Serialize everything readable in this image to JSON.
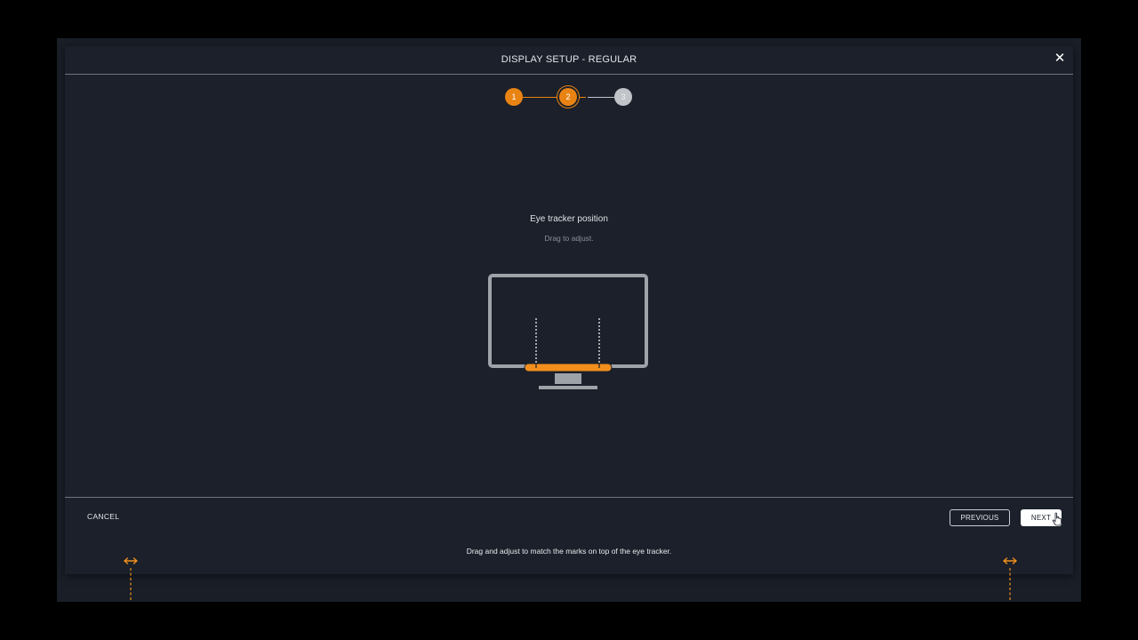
{
  "dialog": {
    "title": "DISPLAY SETUP - REGULAR",
    "close_icon": "close-icon",
    "close_glyph": "✕"
  },
  "stepper": {
    "steps": [
      {
        "label": "1",
        "state": "completed"
      },
      {
        "label": "2",
        "state": "active"
      },
      {
        "label": "3",
        "state": "pending"
      }
    ],
    "current_step": 2,
    "active_color": "#e98414",
    "pending_color": "#c0c4c9"
  },
  "content": {
    "title": "Eye tracker position",
    "hint": "Drag to adjust.",
    "illustration": {
      "monitor_color": "#9ea3aa",
      "tracker_color": "#f28f1c",
      "icon": "monitor-with-eye-tracker-icon"
    }
  },
  "footer": {
    "cancel_label": "CANCEL",
    "previous_label": "PREVIOUS",
    "next_label": "NEXT"
  },
  "screen_overlay": {
    "instruction": "Drag and adjust to match the marks on top of the eye tracker.",
    "marker_icon": "horizontal-resize-arrow-icon",
    "marker_color": "#f28f1c"
  },
  "colors": {
    "background": "#191e27",
    "dialog_background": "#1b202a",
    "accent": "#e98414",
    "text": "#e3e6ea"
  }
}
